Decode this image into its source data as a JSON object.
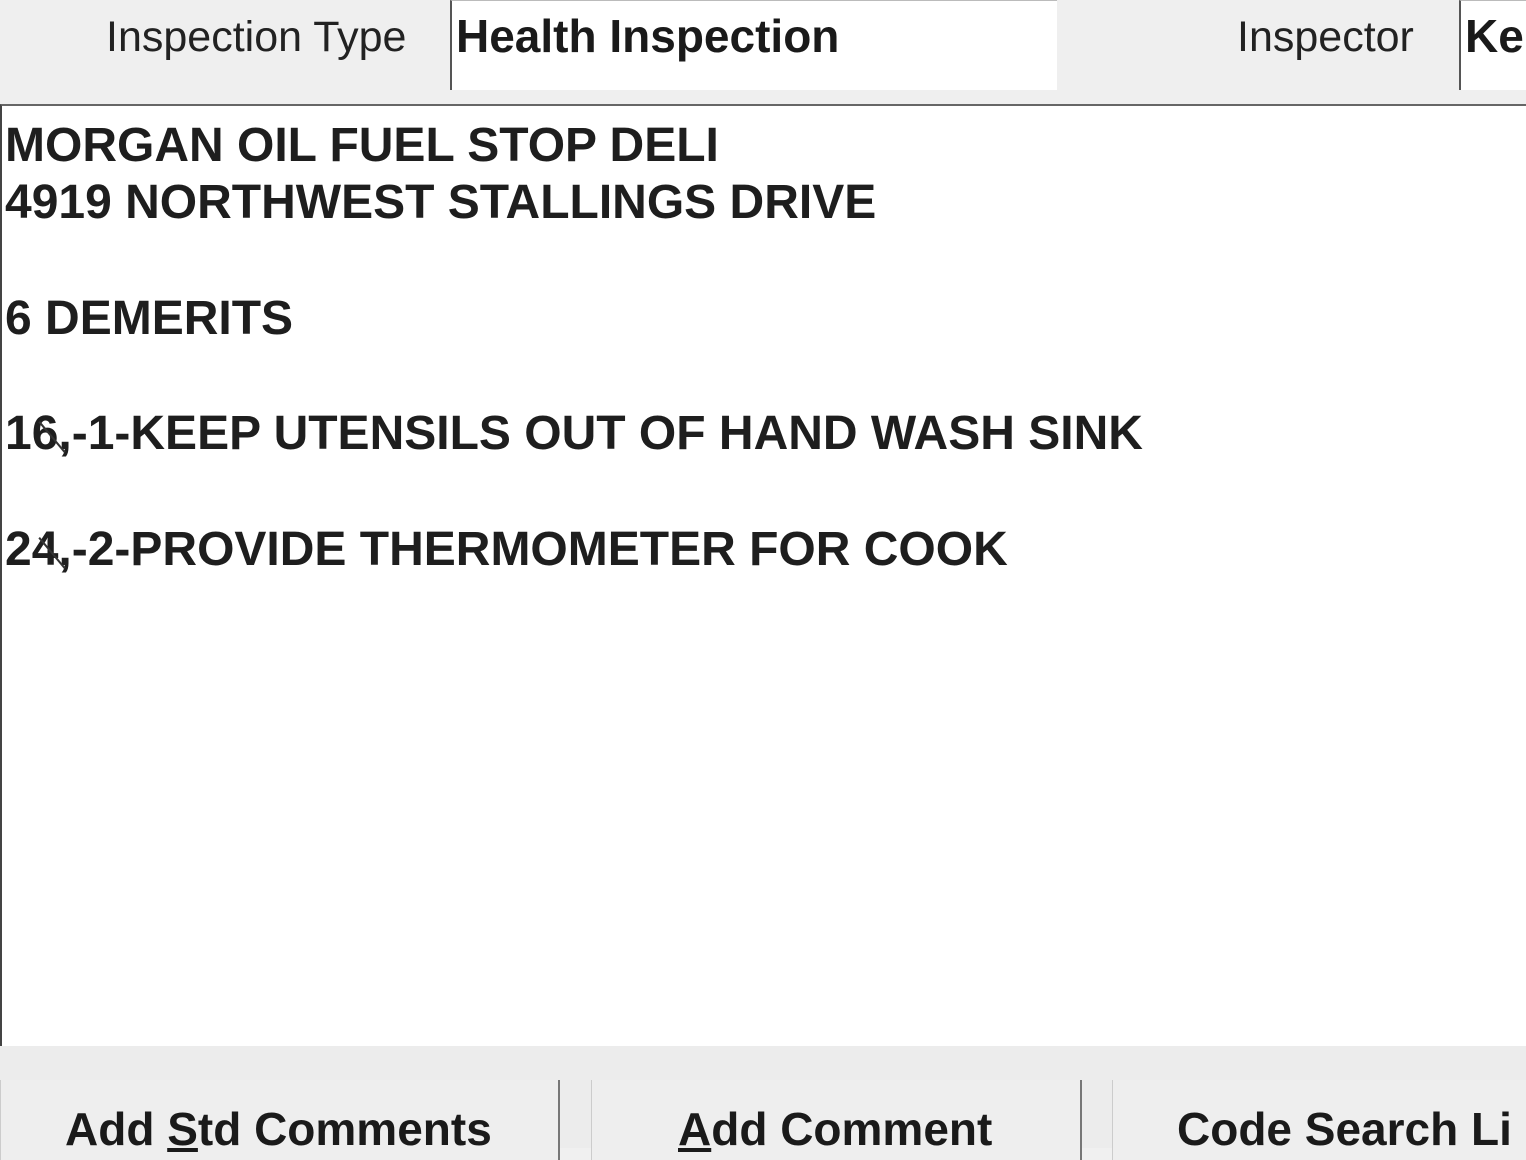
{
  "header": {
    "inspection_type_label": "Inspection Type",
    "inspection_type_value": "Health Inspection",
    "inspector_label": "Inspector",
    "inspector_value": "Ke"
  },
  "comments": {
    "establishment_name": "MORGAN OIL FUEL STOP DELI",
    "address": "4919 NORTHWEST STALLINGS DRIVE",
    "demerits": "6 DEMERITS",
    "violations": [
      "16,-1-KEEP UTENSILS OUT OF HAND WASH SINK",
      "24,-2-PROVIDE THERMOMETER FOR COOK"
    ]
  },
  "buttons": {
    "add_std_comments": {
      "pre": "Add ",
      "underline": "S",
      "post": "td Comments"
    },
    "add_comment": {
      "pre": "",
      "underline": "A",
      "post": "dd Comment"
    },
    "code_search": {
      "pre": "Code Search Li",
      "underline": "",
      "post": ""
    }
  }
}
